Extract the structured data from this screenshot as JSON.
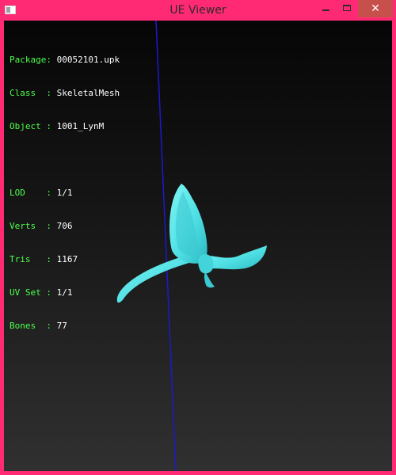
{
  "window": {
    "title": "UE Viewer"
  },
  "controls": {
    "minimize": "–",
    "maximize": "□",
    "close": "✕"
  },
  "info": {
    "rows1": [
      {
        "key": "Package: ",
        "value": "00052101.upk"
      },
      {
        "key": "Class  : ",
        "value": "SkeletalMesh"
      },
      {
        "key": "Object : ",
        "value": "1001_LynM"
      }
    ],
    "rows2": [
      {
        "key": "LOD    : ",
        "value": "1/1"
      },
      {
        "key": "Verts  : ",
        "value": "706"
      },
      {
        "key": "Tris   : ",
        "value": "1167"
      },
      {
        "key": "UV Set : ",
        "value": "1/1"
      },
      {
        "key": "Bones  : ",
        "value": "77"
      }
    ]
  },
  "colors": {
    "frame": "#ff2a73",
    "label": "#4cff4c",
    "value": "#ffffff",
    "mesh": "#55e8e8",
    "axis": "#1a1acc"
  },
  "icons": {
    "app": "app-window-icon"
  }
}
